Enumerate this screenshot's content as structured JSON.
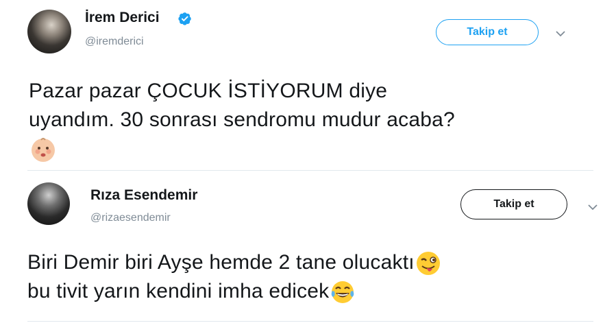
{
  "tweets": [
    {
      "name": "İrem Derici",
      "handle": "@iremderici",
      "verified": true,
      "follow_label": "Takip et",
      "text_line1": "Pazar pazar ÇOCUK İSTİYORUM diye",
      "text_line2": "uyandım. 30 sonrası sendromu mudur acaba?",
      "emoji_name": "baby-face"
    },
    {
      "name": "Rıza Esendemir",
      "handle": "@rizaesendemir",
      "verified": false,
      "follow_label": "Takip et",
      "text_line1": "Biri Demir biri Ayşe hemde 2 tane olucaktı",
      "text_line2": "bu tivit yarın kendini imha edicek",
      "emoji_1": "winking-tongue-face",
      "emoji_2": "tears-of-joy-face"
    }
  ],
  "colors": {
    "accent": "#1da1f2",
    "text": "#14171a",
    "muted": "#7f8b96",
    "divider": "#e1e8ed"
  }
}
